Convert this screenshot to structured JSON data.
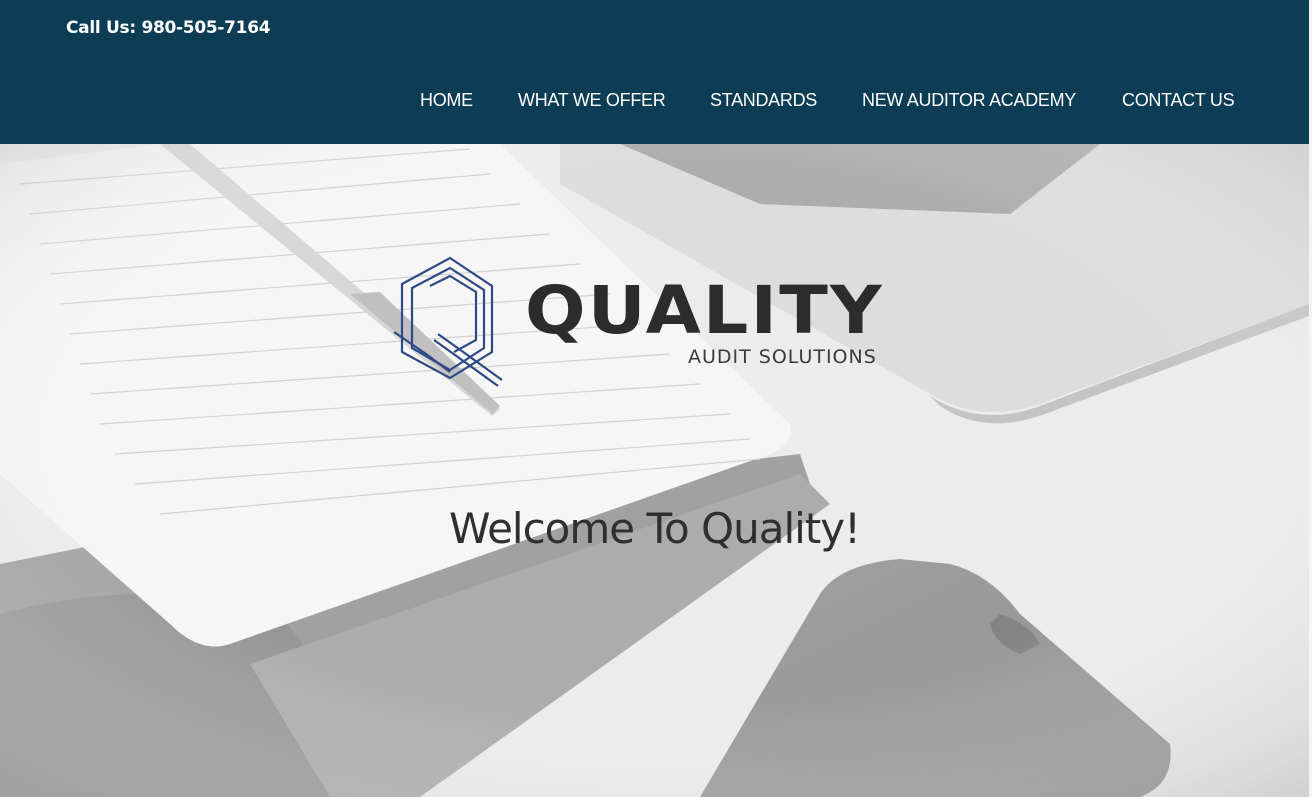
{
  "header": {
    "phone": "Call Us: 980-505-7164",
    "nav": [
      {
        "label": "HOME"
      },
      {
        "label": "WHAT WE OFFER"
      },
      {
        "label": "STANDARDS"
      },
      {
        "label": "NEW AUDITOR ACADEMY"
      },
      {
        "label": "CONTACT US"
      }
    ]
  },
  "hero": {
    "logo": {
      "word": "QUALITY",
      "subtitle": "AUDIT SOLUTIONS"
    },
    "headline": "Welcome To Quality!"
  },
  "colors": {
    "header_bg": "#0d3c55",
    "nav_text": "#ffffff",
    "logo_mark": "#2e4a85",
    "logo_text": "#2c2c2c"
  },
  "icons": {
    "logo_mark": "quality-q-logo-icon"
  }
}
